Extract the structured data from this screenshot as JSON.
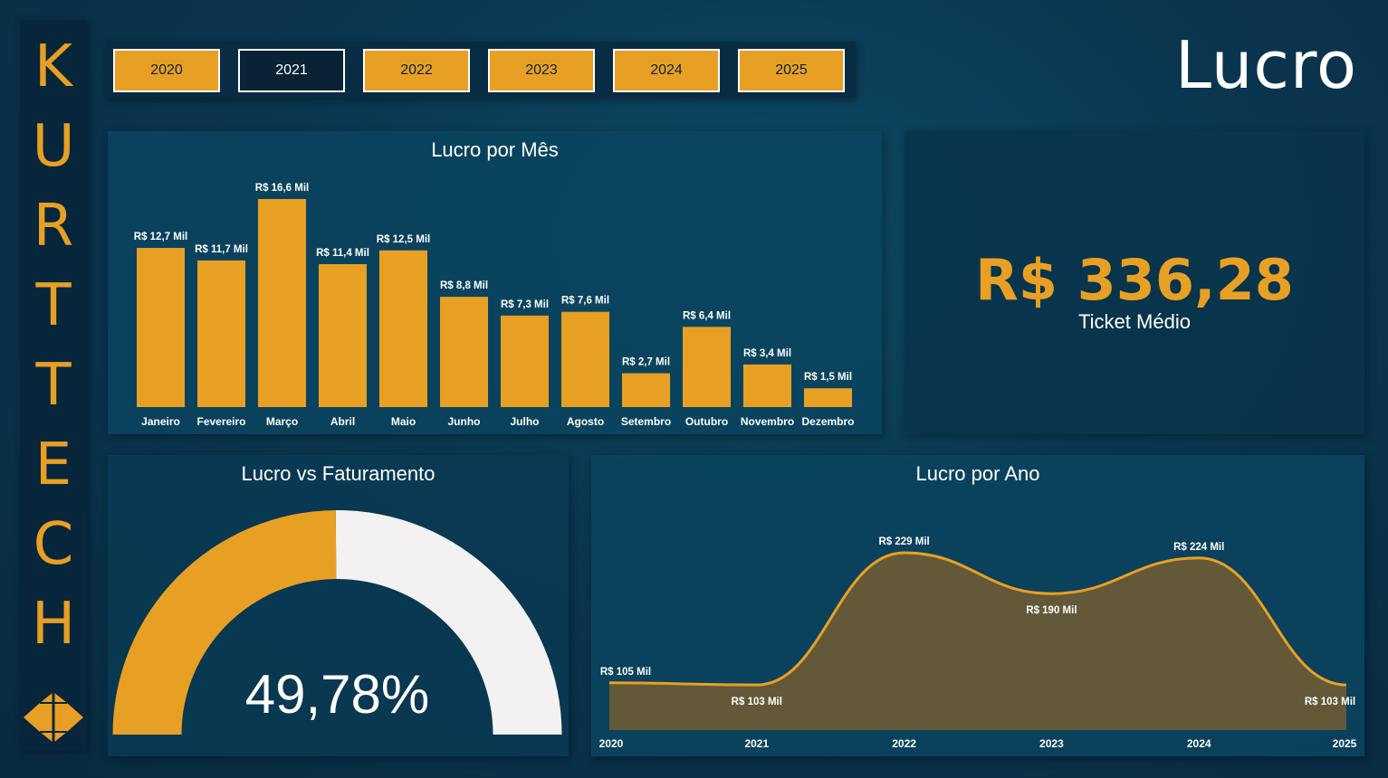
{
  "brand": {
    "letters": [
      "K",
      "U",
      "R",
      "T",
      "T",
      "E",
      "C",
      "H"
    ]
  },
  "page_title": "Lucro",
  "years": [
    {
      "label": "2020",
      "active": false
    },
    {
      "label": "2021",
      "active": true
    },
    {
      "label": "2022",
      "active": false
    },
    {
      "label": "2023",
      "active": false
    },
    {
      "label": "2024",
      "active": false
    },
    {
      "label": "2025",
      "active": false
    }
  ],
  "ticket": {
    "value": "R$ 336,28",
    "label": "Ticket Médio"
  },
  "colors": {
    "accent": "#e8a024",
    "dark": "#0b2235",
    "gauge_rest": "#f3f1f1",
    "area_fill": "#6b5a34"
  },
  "chart_data": [
    {
      "type": "bar",
      "title": "Lucro por Mês",
      "categories": [
        "Janeiro",
        "Fevereiro",
        "Março",
        "Abril",
        "Maio",
        "Junho",
        "Julho",
        "Agosto",
        "Setembro",
        "Outubro",
        "Novembro",
        "Dezembro"
      ],
      "values": [
        12.7,
        11.7,
        16.6,
        11.4,
        12.5,
        8.8,
        7.3,
        7.6,
        2.7,
        6.4,
        3.4,
        1.5
      ],
      "data_labels": [
        "R$ 12,7 Mil",
        "R$ 11,7 Mil",
        "R$ 16,6 Mil",
        "R$ 11,4 Mil",
        "R$ 12,5 Mil",
        "R$ 8,8 Mil",
        "R$ 7,3 Mil",
        "R$ 7,6 Mil",
        "R$ 2,7 Mil",
        "R$ 6,4 Mil",
        "R$ 3,4 Mil",
        "R$ 1,5 Mil"
      ],
      "unit": "R$ Mil",
      "color": "#e8a024"
    },
    {
      "type": "pie",
      "title": "Lucro vs Faturamento",
      "value": 49.78,
      "value_label": "49,78%",
      "max": 100
    },
    {
      "type": "area",
      "title": "Lucro por Ano",
      "x": [
        "2020",
        "2021",
        "2022",
        "2023",
        "2024",
        "2025"
      ],
      "values": [
        105,
        103,
        229,
        190,
        224,
        103
      ],
      "data_labels": [
        "R$ 105 Mil",
        "R$ 103 Mil",
        "R$ 229 Mil",
        "R$ 190 Mil",
        "R$ 224 Mil",
        "R$ 103 Mil"
      ],
      "unit": "R$ Mil",
      "color": "#e8a024"
    }
  ]
}
